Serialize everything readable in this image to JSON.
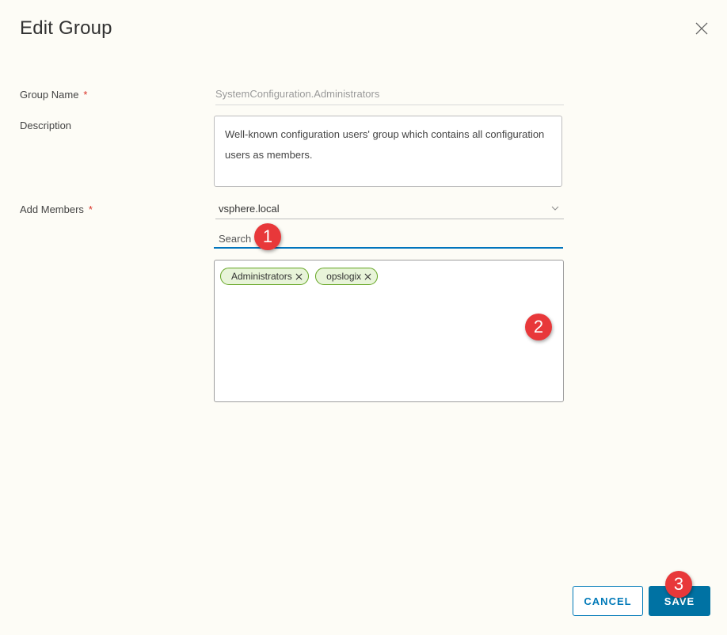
{
  "dialog": {
    "title": "Edit Group"
  },
  "form": {
    "group_name": {
      "label": "Group Name",
      "required_mark": "*",
      "value": "SystemConfiguration.Administrators"
    },
    "description": {
      "label": "Description",
      "value": "Well-known configuration users' group which contains all configuration users as members."
    },
    "add_members": {
      "label": "Add Members",
      "required_mark": "*",
      "domain_selected": "vsphere.local",
      "search_placeholder": "Search",
      "members": [
        {
          "label": "Administrators"
        },
        {
          "label": "opslogix"
        }
      ]
    }
  },
  "annotations": [
    "1",
    "2",
    "3"
  ],
  "buttons": {
    "cancel": "CANCEL",
    "save": "SAVE"
  },
  "colors": {
    "primary": "#0072a3",
    "chip_border": "#62a420",
    "chip_fill": "#e8f4d9",
    "required": "#d93025",
    "callout": "#e8383a"
  },
  "icons": {
    "close": "close-icon",
    "dropdown": "chevron-down-icon",
    "remove": "close-icon"
  }
}
